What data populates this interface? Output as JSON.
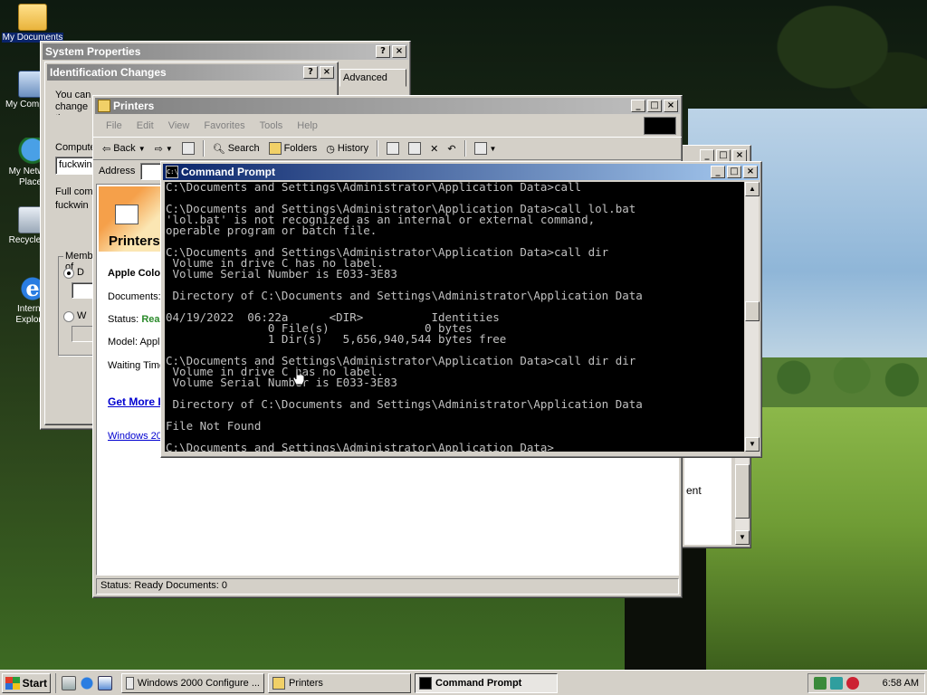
{
  "desktop": {
    "icons": [
      {
        "label": "My Documents",
        "icon": "folder-icon"
      },
      {
        "label": "My Computer",
        "icon": "computer-icon"
      },
      {
        "label": "My Network Places",
        "icon": "network-icon"
      },
      {
        "label": "Recycle Bin",
        "icon": "recycle-bin-icon"
      },
      {
        "label": "Internet Explorer",
        "icon": "ie-icon"
      }
    ]
  },
  "system_properties": {
    "title": "System Properties",
    "tab_advanced": "Advanced"
  },
  "identification_changes": {
    "title": "Identification Changes",
    "desc": "You can change the name and the membership of this computer.",
    "computer_name_label": "Computer name:",
    "computer_name_value": "fuckwin",
    "full_name_label": "Full computer name:",
    "full_name_value": "fuckwin",
    "member_of": "Member of",
    "domain_short": "D",
    "workgroup_short": "W"
  },
  "printers": {
    "title": "Printers",
    "menu": [
      "File",
      "Edit",
      "View",
      "Favorites",
      "Tools",
      "Help"
    ],
    "toolbar": {
      "back": "Back",
      "search": "Search",
      "folders": "Folders",
      "history": "History"
    },
    "address_label": "Address",
    "heading": "Printers",
    "selected_printer": "Apple Colo",
    "documents_label": "Documents:",
    "status_label": "Status:",
    "status_value": "Rea",
    "model_label": "Model: Apple",
    "waiting_label": "Waiting Time",
    "get_more": "Get More I",
    "windows_link": "Windows 20",
    "status_bar": "Status: Ready Documents: 0"
  },
  "behind_window": {
    "fragment": "ent"
  },
  "cmd": {
    "title": "Command Prompt",
    "lines": [
      "C:\\Documents and Settings\\Administrator\\Application Data>call",
      "",
      "C:\\Documents and Settings\\Administrator\\Application Data>call lol.bat",
      "'lol.bat' is not recognized as an internal or external command,",
      "operable program or batch file.",
      "",
      "C:\\Documents and Settings\\Administrator\\Application Data>call dir",
      " Volume in drive C has no label.",
      " Volume Serial Number is E033-3E83",
      "",
      " Directory of C:\\Documents and Settings\\Administrator\\Application Data",
      "",
      "04/19/2022  06:22a      <DIR>          Identities",
      "               0 File(s)              0 bytes",
      "               1 Dir(s)   5,656,940,544 bytes free",
      "",
      "C:\\Documents and Settings\\Administrator\\Application Data>call dir dir",
      " Volume in drive C has no label.",
      " Volume Serial Number is E033-3E83",
      "",
      " Directory of C:\\Documents and Settings\\Administrator\\Application Data",
      "",
      "File Not Found",
      "",
      "C:\\Documents and Settings\\Administrator\\Application Data>"
    ]
  },
  "taskbar": {
    "start": "Start",
    "tasks": [
      {
        "label": "Windows 2000 Configure ...",
        "active": false
      },
      {
        "label": "Printers",
        "active": false
      },
      {
        "label": "Command Prompt",
        "active": true
      }
    ],
    "clock": "6:58 AM"
  }
}
